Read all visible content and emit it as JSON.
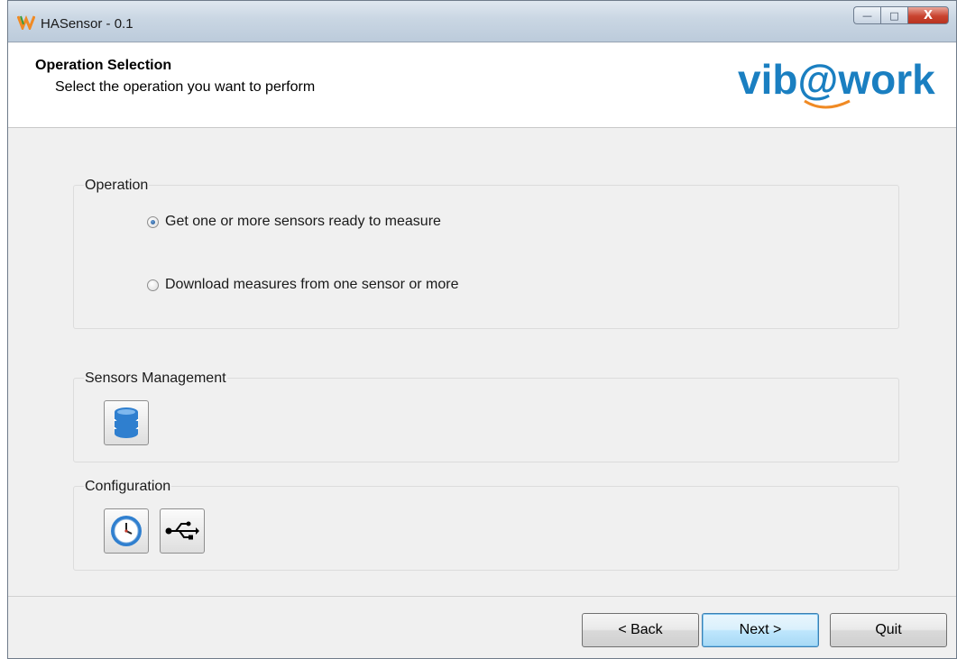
{
  "window": {
    "title": "HASensor - 0.1"
  },
  "titlebar_buttons": {
    "minimize": "—",
    "maximize": "□",
    "close": "X"
  },
  "header": {
    "title": "Operation Selection",
    "subtitle": "Select the operation you want to perform",
    "logo_text": "vib@work"
  },
  "operation": {
    "label": "Operation",
    "options": [
      {
        "label": "Get one or more sensors ready to measure",
        "checked": true
      },
      {
        "label": "Download measures from one sensor or more",
        "checked": false
      }
    ]
  },
  "sensors_management": {
    "label": "Sensors Management",
    "icon": "database-icon"
  },
  "configuration": {
    "label": "Configuration",
    "icons": [
      "clock-icon",
      "usb-icon"
    ]
  },
  "footer": {
    "back": "< Back",
    "next": "Next >",
    "quit": "Quit"
  },
  "colors": {
    "logo_blue": "#1a7fc1",
    "logo_orange": "#f08a24",
    "accent": "#3c7fb1"
  }
}
